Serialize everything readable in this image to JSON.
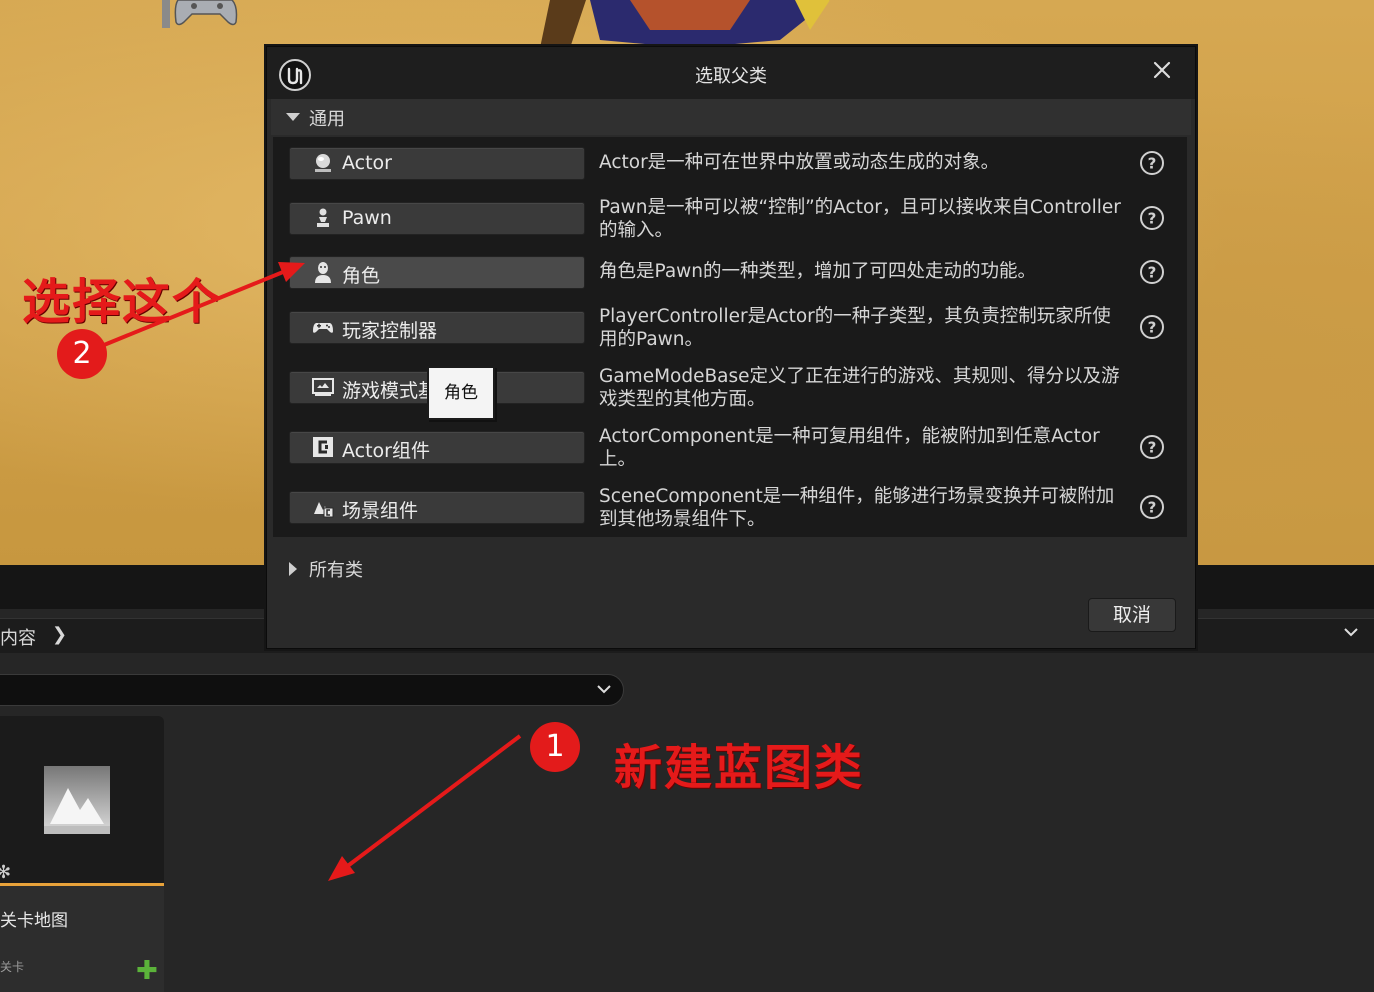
{
  "dialog": {
    "title": "选取父类",
    "close_icon": "close-icon",
    "section_common": "通用",
    "section_all_classes": "所有类",
    "cancel_label": "取消",
    "tooltip": "角色",
    "classes": [
      {
        "label": "Actor",
        "icon": "actor-sphere-icon",
        "description": "Actor是一种可在世界中放置或动态生成的对象。",
        "help": true
      },
      {
        "label": "Pawn",
        "icon": "pawn-icon",
        "description": "Pawn是一种可以被“控制”的Actor，且可以接收来自Controller的输入。",
        "help": true
      },
      {
        "label": "角色",
        "icon": "character-icon",
        "description": "角色是Pawn的一种类型，增加了可四处走动的功能。",
        "help": true
      },
      {
        "label": "玩家控制器",
        "icon": "gamepad-icon",
        "description": "PlayerController是Actor的一种子类型，其负责控制玩家所使用的Pawn。",
        "help": true
      },
      {
        "label": "游戏模式基础",
        "icon": "game-mode-icon",
        "description": "GameModeBase定义了正在进行的游戏、其规则、得分以及游戏类型的其他方面。",
        "help": false
      },
      {
        "label": "Actor组件",
        "icon": "actor-component-icon",
        "description": "ActorComponent是一种可复用组件，能被附加到任意Actor上。",
        "help": true
      },
      {
        "label": "场景组件",
        "icon": "scene-component-icon",
        "description": "SceneComponent是一种组件，能够进行场景变换并可被附加到其他场景组件下。",
        "help": true
      }
    ]
  },
  "content_browser": {
    "path_label": "内容",
    "asset": {
      "name": "关卡地图",
      "type": "关卡"
    }
  },
  "annotations": {
    "select_this": "选择这个",
    "select_this_num": "2",
    "new_blueprint": "新建蓝图类",
    "new_blueprint_num": "1",
    "color": "#e51a1a"
  }
}
